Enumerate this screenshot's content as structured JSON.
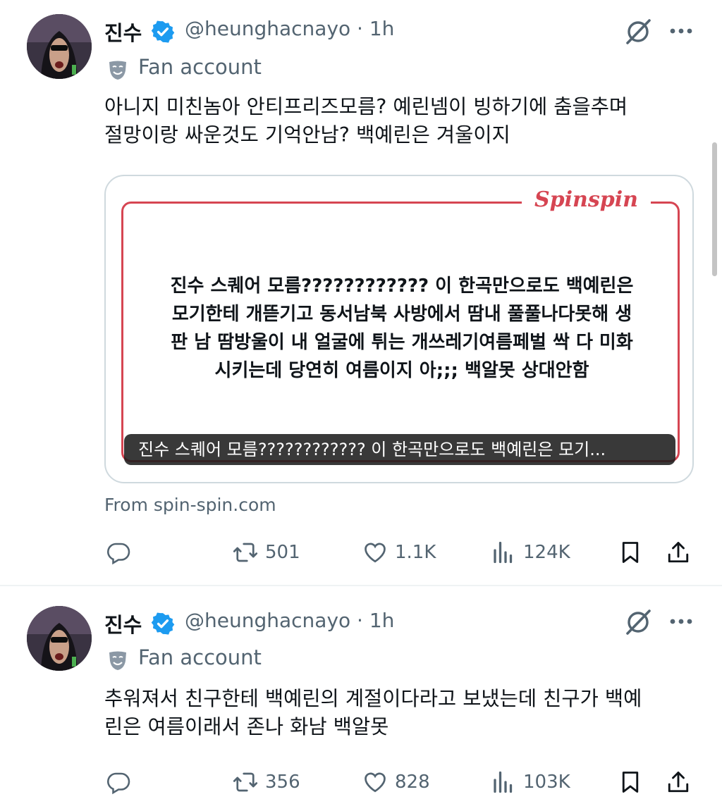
{
  "tweets": [
    {
      "author_name": "진수",
      "handle_time": "@heunghacnayo · 1h",
      "badge_label": "Fan account",
      "text_lines": [
        "아니지 미친놈아 안티프리즈모름? 예린넴이 빙하기에 춤을추며",
        "절망이랑 싸운것도 기억안남? 백예린은 겨울이지"
      ],
      "card": {
        "logo": "Spinspin",
        "body_lines": [
          "진수 스퀘어 모름???????????? 이 한곡만으로도 백예린은",
          "모기한테 개뜯기고 동서남북 사방에서 땀내 풀풀나다못해 생",
          "판 남 땀방울이 내 얼굴에 튀는 개쓰레기여름페벌 싹 다 미화",
          "시키는데 당연히 여름이지 아;;; 백알못 상대안함"
        ],
        "caption": "진수 스퀘어 모름???????????? 이 한곡만으로도 백예린은 모기..."
      },
      "source": "From spin-spin.com",
      "retweets": "501",
      "likes": "1.1K",
      "views": "124K"
    },
    {
      "author_name": "진수",
      "handle_time": "@heunghacnayo · 1h",
      "badge_label": "Fan account",
      "text_lines": [
        "추워져서 친구한테 백예린의 계절이다라고 보냈는데 친구가 백예",
        "린은 여름이래서 존나 화남 백알못"
      ],
      "retweets": "356",
      "likes": "828",
      "views": "103K"
    }
  ],
  "icons": {
    "verified": "verified-badge-icon",
    "grok": "grok-slash-icon",
    "more": "more-options-icon",
    "fan": "theater-mask-icon",
    "reply": "reply-icon",
    "retweet": "retweet-icon",
    "like": "heart-icon",
    "views": "views-bars-icon",
    "bookmark": "bookmark-icon",
    "share": "share-icon"
  },
  "colors": {
    "verified": "#1d9bf0",
    "secondary_text": "#536471",
    "card_accent": "#d64552"
  }
}
